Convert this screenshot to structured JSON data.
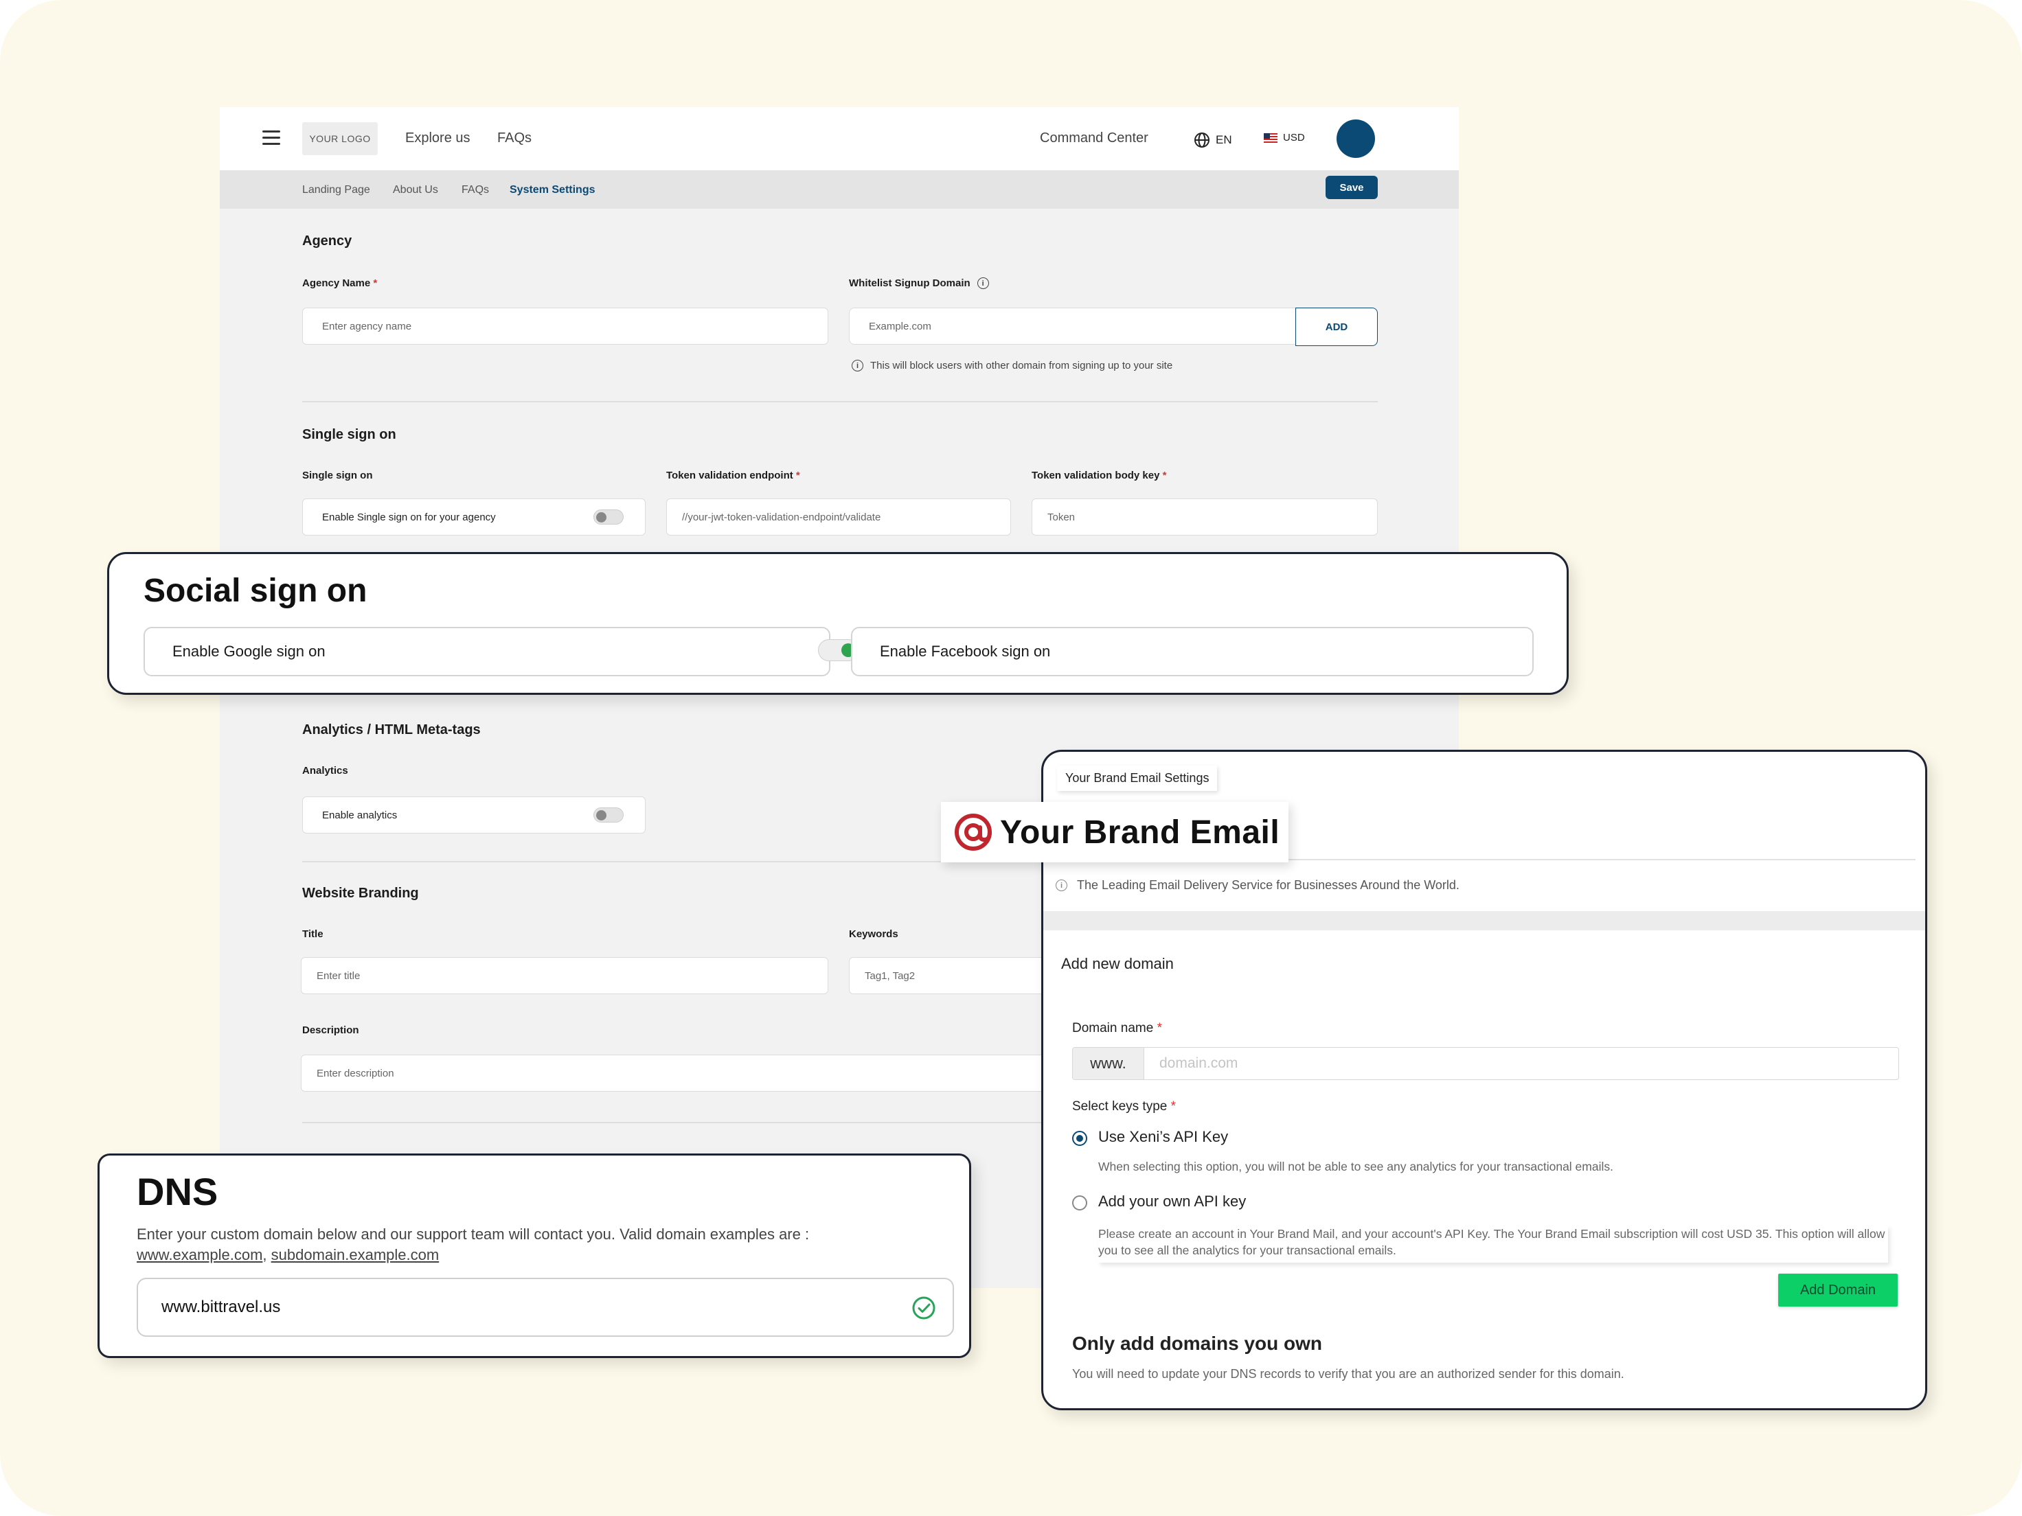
{
  "topbar": {
    "logo": "YOUR LOGO",
    "nav": [
      "Explore us",
      "FAQs"
    ],
    "command_center": "Command Center",
    "language": "EN",
    "currency": "USD"
  },
  "subnav": {
    "items": [
      "Landing Page",
      "About Us",
      "FAQs",
      "System Settings"
    ],
    "save": "Save"
  },
  "agency": {
    "title": "Agency",
    "name_label": "Agency Name",
    "name_placeholder": "Enter agency name",
    "whitelist_label": "Whitelist Signup Domain",
    "whitelist_placeholder": "Example.com",
    "add": "ADD",
    "hint": "This will block users with other domain from signing up to your site"
  },
  "sso": {
    "title": "Single sign on",
    "sso_label": "Single sign on",
    "sso_toggle_text": "Enable Single sign on for your agency",
    "endpoint_label": "Token validation endpoint",
    "endpoint_placeholder": "//your-jwt-token-validation-endpoint/validate",
    "bodykey_label": "Token validation body key",
    "bodykey_placeholder": "Token"
  },
  "social": {
    "title": "Social sign on",
    "google": "Enable Google sign on",
    "facebook": "Enable Facebook sign on"
  },
  "analytics": {
    "title": "Analytics / HTML Meta-tags",
    "label": "Analytics",
    "toggle_text": "Enable analytics"
  },
  "branding": {
    "title": "Website Branding",
    "title_label": "Title",
    "title_placeholder": "Enter title",
    "keywords_label": "Keywords",
    "keywords_placeholder": "Tag1, Tag2",
    "description_label": "Description",
    "description_placeholder": "Enter description"
  },
  "dns": {
    "title": "DNS",
    "desc": "Enter your custom domain below and our support team will contact you. Valid domain examples are :",
    "example1": "www.example.com",
    "example2": "subdomain.example.com",
    "value": "www.bittravel.us"
  },
  "email": {
    "tab": "Your Brand Email Settings",
    "brand": "Your Brand Email",
    "tagline": "The Leading Email Delivery Service for Businesses Around the World.",
    "add_new": "Add new domain",
    "domain_label": "Domain name",
    "domain_prefix": "www.",
    "domain_placeholder": "domain.com",
    "keys_label": "Select keys type",
    "option1": "Use Xeni’s API Key",
    "option1_desc": "When selecting this option, you will not be able to see any analytics for your transactional emails.",
    "option2": "Add your own API key",
    "option2_desc": "Please create an account in Your Brand Mail, and your account's API Key. The Your Brand Email subscription will cost USD 35. This option will allow you to see all the analytics for your transactional emails.",
    "add_domain": "Add Domain",
    "own_title": "Only add domains you own",
    "own_desc": "You will need to update your DNS records to verify that you are an authorized sender for this domain."
  },
  "colors": {
    "primary": "#0b4a74",
    "accent_green": "#0ccf68",
    "background": "#fdf9ea"
  }
}
